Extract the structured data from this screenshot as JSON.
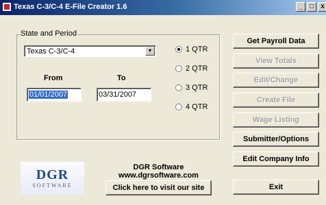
{
  "window": {
    "title": "Texas C-3/C-4 E-File Creator 1.6",
    "controls": {
      "minimize": "_",
      "maximize": "□",
      "close": "x"
    }
  },
  "state_period": {
    "legend": "State and Period",
    "state_select": {
      "value": "Texas C-3/C-4",
      "arrow": "▼"
    },
    "from_label": "From",
    "to_label": "To",
    "from_value": "01/01/2007",
    "to_value": "03/31/2007",
    "quarters": [
      {
        "label": "1 QTR",
        "checked": true
      },
      {
        "label": "2 QTR",
        "checked": false
      },
      {
        "label": "3 QTR",
        "checked": false
      },
      {
        "label": "4 QTR",
        "checked": false
      }
    ]
  },
  "actions": [
    {
      "label": "Get Payroll Data",
      "enabled": true
    },
    {
      "label": "View Totals",
      "enabled": false
    },
    {
      "label": "Edit/Change",
      "enabled": false
    },
    {
      "label": "Create File",
      "enabled": false
    },
    {
      "label": "Wage Listing",
      "enabled": false
    },
    {
      "label": "Submitter/Options",
      "enabled": true
    },
    {
      "label": "Edit Company Info",
      "enabled": true
    },
    {
      "label": "Exit",
      "enabled": true
    }
  ],
  "company": {
    "logo_main": "DGR",
    "logo_sub": "SOFTWARE",
    "name": "DGR Software",
    "url": "www.dgrsoftware.com",
    "visit_button": "Click here to visit our site"
  }
}
